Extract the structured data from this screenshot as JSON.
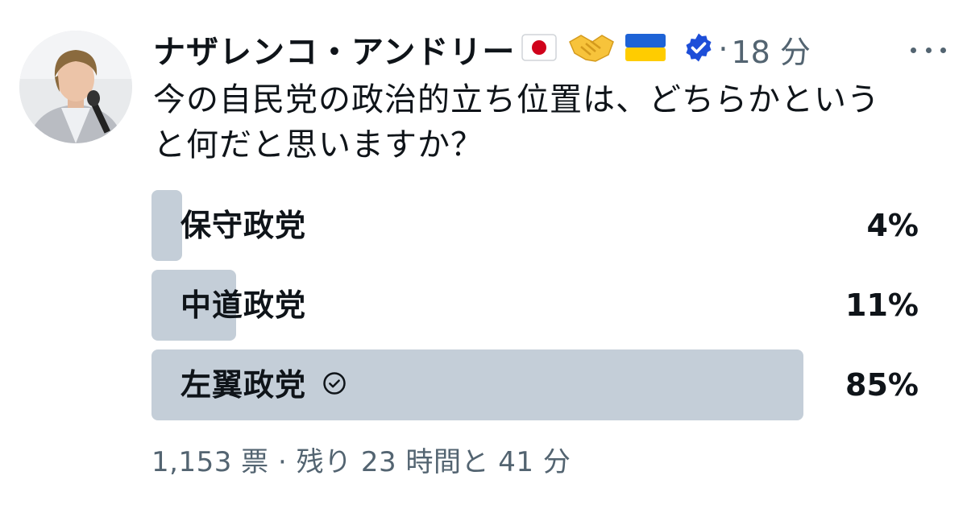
{
  "author": {
    "name": "ナザレンコ・アンドリー",
    "emojis": [
      "japan-flag",
      "handshake",
      "ukraine-flag"
    ],
    "verified_icon": "verified-badge-icon",
    "separator": "·",
    "time": "18 分"
  },
  "post": {
    "question_line1": "今の自民党の政治的立ち位置は、どちらかという",
    "question_line2": "と何だと思いますか？"
  },
  "poll": {
    "options": [
      {
        "label": "保守政党",
        "percent_text": "4%",
        "percent": 4,
        "selected": false
      },
      {
        "label": "中道政党",
        "percent_text": "11%",
        "percent": 11,
        "selected": false
      },
      {
        "label": "左翼政党",
        "percent_text": "85%",
        "percent": 85,
        "selected": true
      }
    ],
    "footer": "1,153 票 · 残り 23 時間と 41 分"
  },
  "colors": {
    "bar": "#c4ced8",
    "text": "#0f1419",
    "secondary": "#536471",
    "verified": "#1d4ed8"
  }
}
